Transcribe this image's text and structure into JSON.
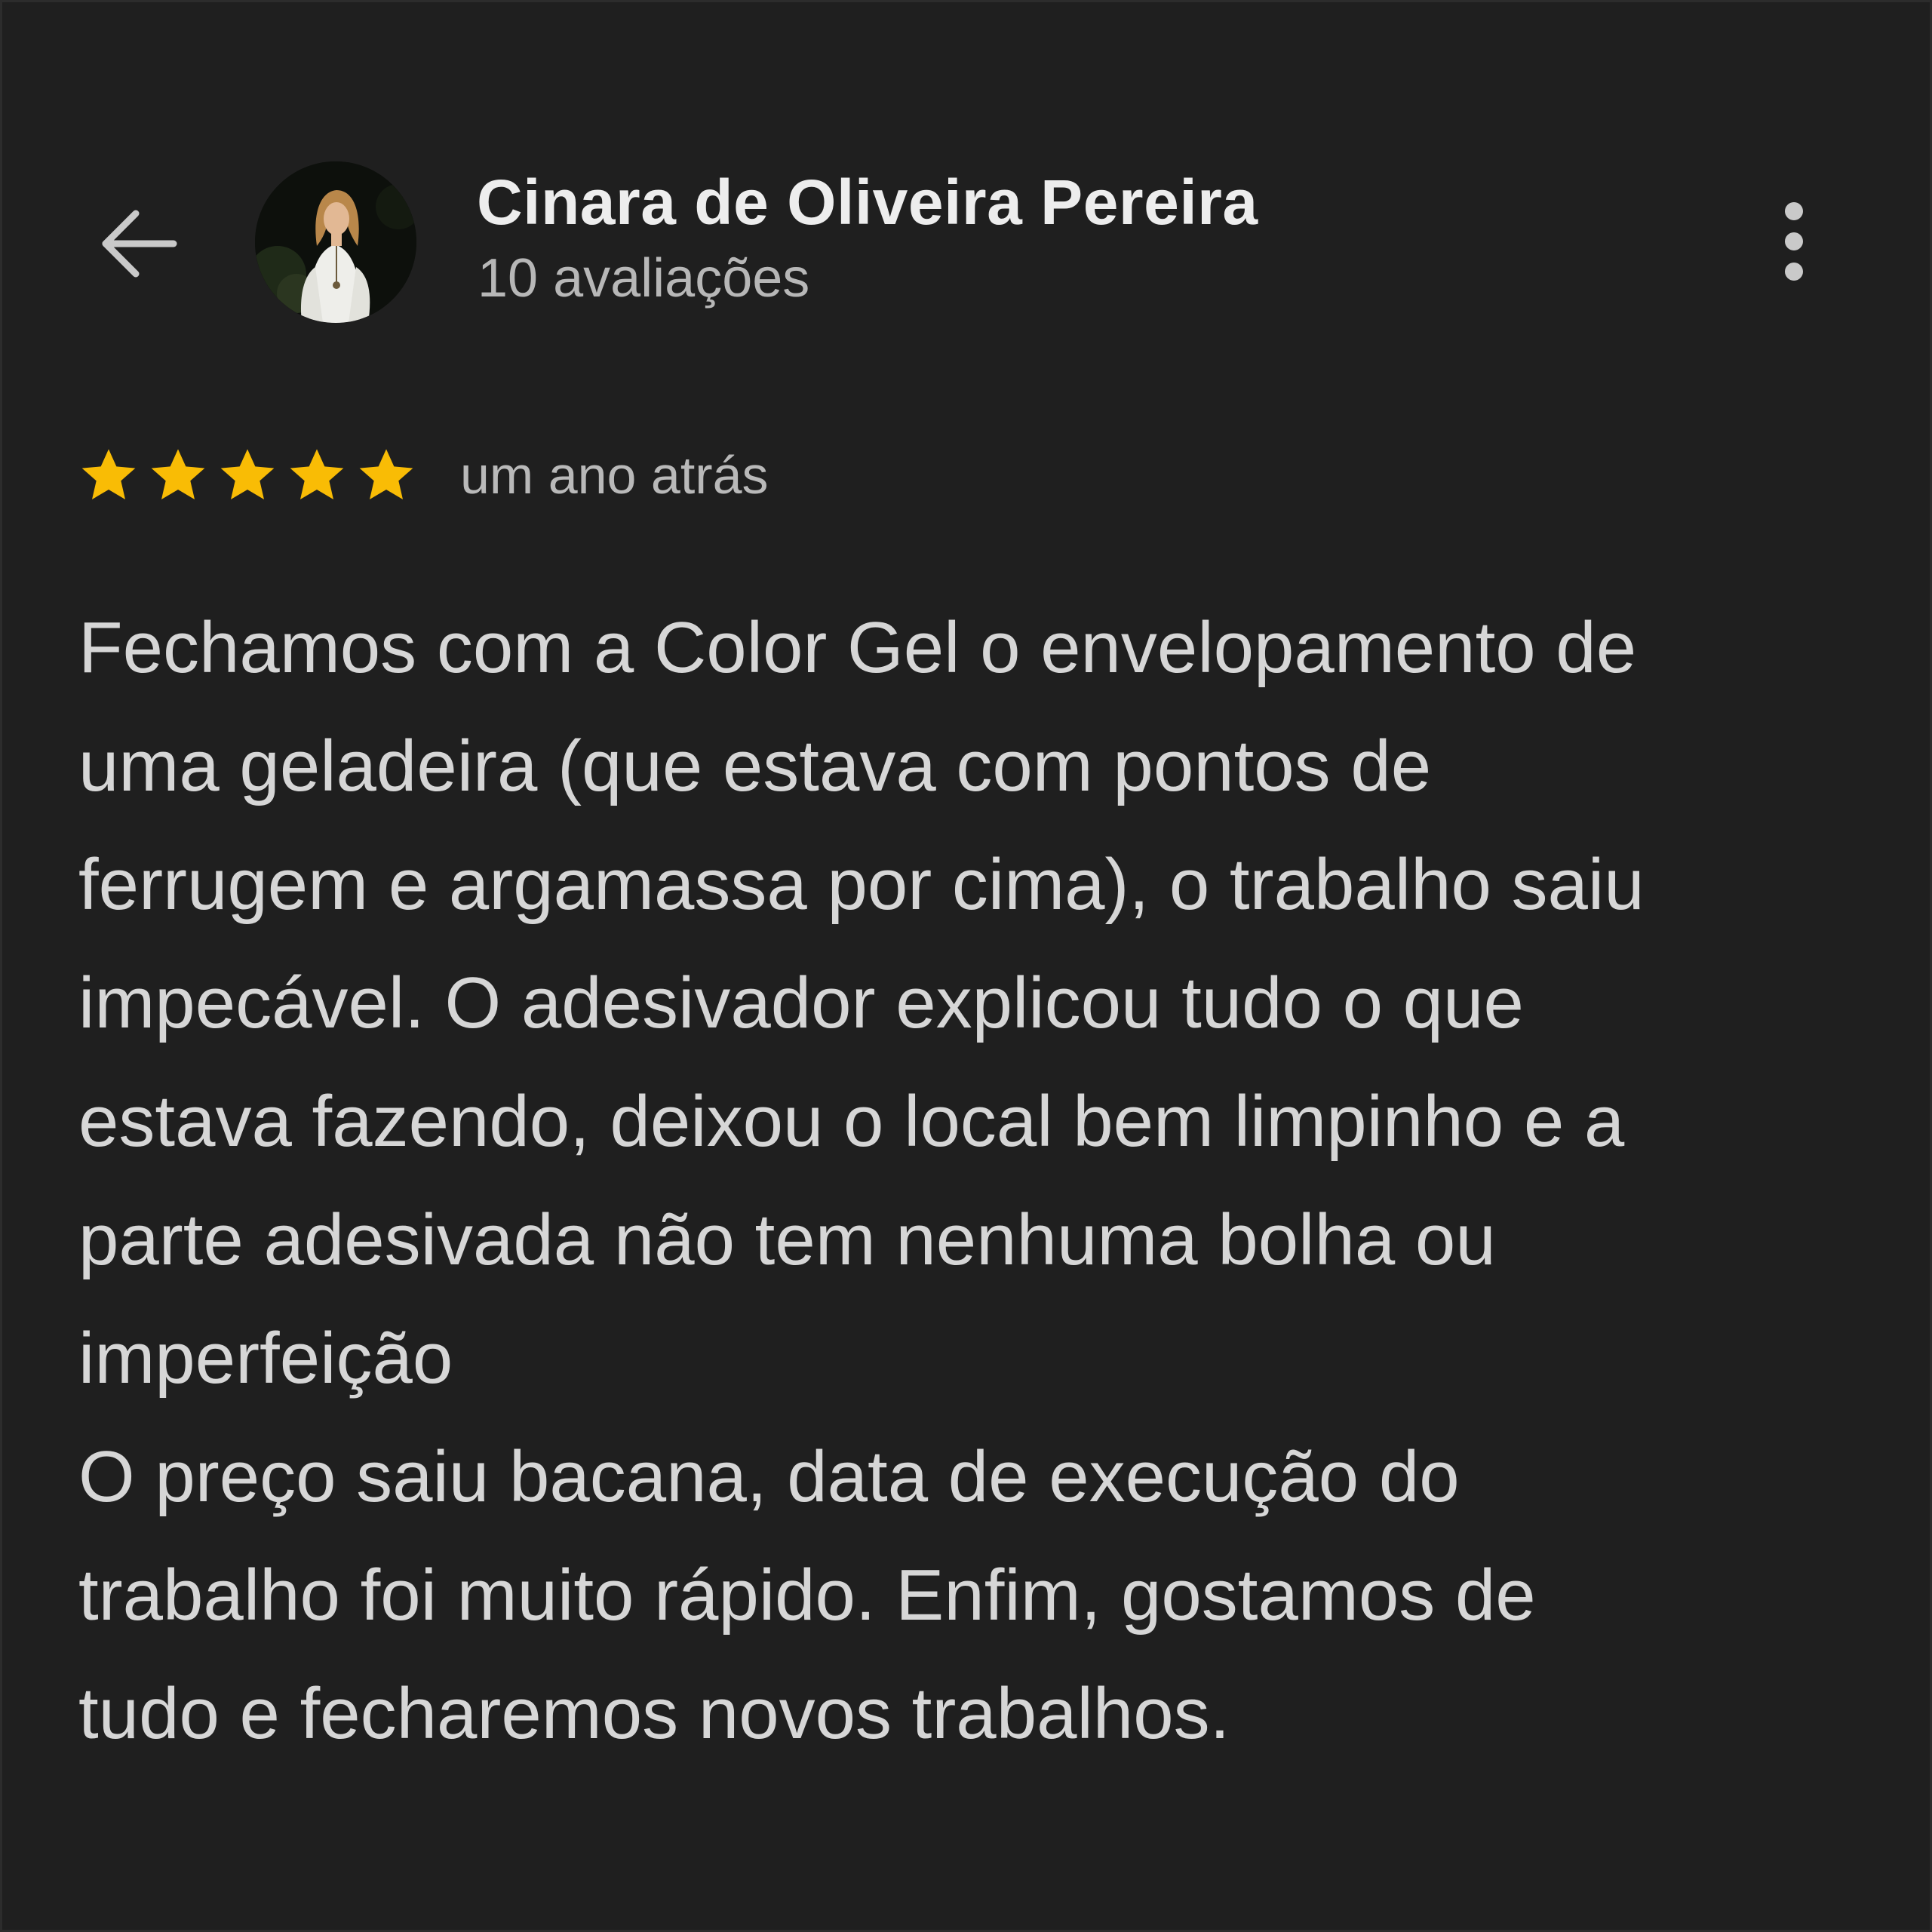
{
  "header": {
    "back_icon": "arrow-left-icon",
    "reviewer_name": "Cinara de Oliveira Pereira",
    "review_count": "10 avaliações",
    "more_icon": "more-vertical-icon"
  },
  "review": {
    "rating": 5,
    "rating_max": 5,
    "star_color": "#f9bc05",
    "date": "um ano atrás",
    "lines": [
      "Fechamos com a Color Gel o envelopamento de",
      "uma geladeira (que estava com pontos de",
      "ferrugem e argamassa por cima), o trabalho saiu",
      "impecável. O adesivador explicou tudo o que",
      "estava fazendo, deixou o local bem limpinho e a",
      "parte adesivada não tem nenhuma bolha ou",
      "imperfeição",
      "O preço saiu bacana, data de execução do",
      "trabalho foi muito rápido. Enfim, gostamos de",
      "tudo e fecharemos novos trabalhos."
    ]
  },
  "colors": {
    "background": "#1f1f1f",
    "text_primary": "#ededed",
    "text_secondary": "#b7b7b7"
  }
}
